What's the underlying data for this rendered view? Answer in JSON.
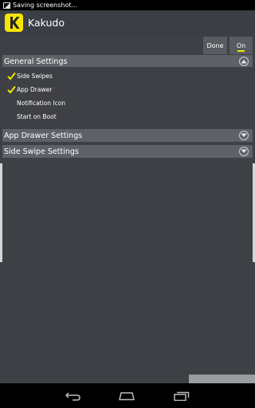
{
  "status_bar": {
    "notification_icon": "screenshot-icon",
    "text": "Saving screenshot..."
  },
  "app": {
    "logo_letter": "K",
    "title": "Kakudo",
    "accent": "#f5e400"
  },
  "controls": {
    "done_label": "Done",
    "on_label": "On"
  },
  "sections": [
    {
      "title": "General Settings",
      "expanded": true,
      "options": [
        {
          "label": "Side Swipes",
          "checked": true
        },
        {
          "label": "App Drawer",
          "checked": true
        },
        {
          "label": "Notification Icon",
          "checked": false
        },
        {
          "label": "Start on Boot",
          "checked": false
        }
      ]
    },
    {
      "title": "App Drawer Settings",
      "expanded": false
    },
    {
      "title": "Side Swipe Settings",
      "expanded": false
    }
  ],
  "nav": {
    "back_icon": "back-icon",
    "home_icon": "home-icon",
    "recents_icon": "recents-icon"
  }
}
